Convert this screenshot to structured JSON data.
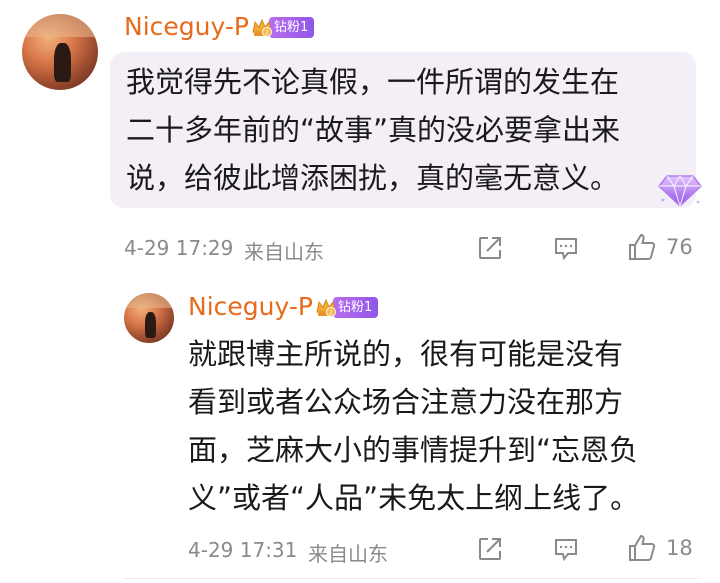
{
  "comment": {
    "username": "Niceguy-P",
    "badge_label": "钻粉1",
    "badge_level": "2",
    "lines": [
      "我觉得先不论真假，一件所谓的发生在",
      "二十多年前的“故事”真的没必要拿出来",
      "说，给彼此增添困扰，真的毫无意义。"
    ],
    "time": "4-29 17:29",
    "location": "来自山东",
    "like_count": "76",
    "icons": [
      "share-icon",
      "reply-icon",
      "like-icon",
      "diamond-badge-icon"
    ]
  },
  "reply": {
    "username": "Niceguy-P",
    "badge_label": "钻粉1",
    "badge_level": "2",
    "lines": [
      "就跟博主所说的，很有可能是没有",
      "看到或者公众场合注意力没在那方",
      "面，芝麻大小的事情提升到“忘恩负",
      "义”或者“人品”未免太上纲上线了。"
    ],
    "time": "4-29 17:31",
    "location": "来自山东",
    "like_count": "18",
    "icons": [
      "share-icon",
      "reply-icon",
      "like-icon"
    ]
  },
  "colors": {
    "username": "#e86a1a",
    "badge": "#9b5ce8",
    "bubble": "#f4eff6",
    "meta_text": "#8a8a8a"
  }
}
